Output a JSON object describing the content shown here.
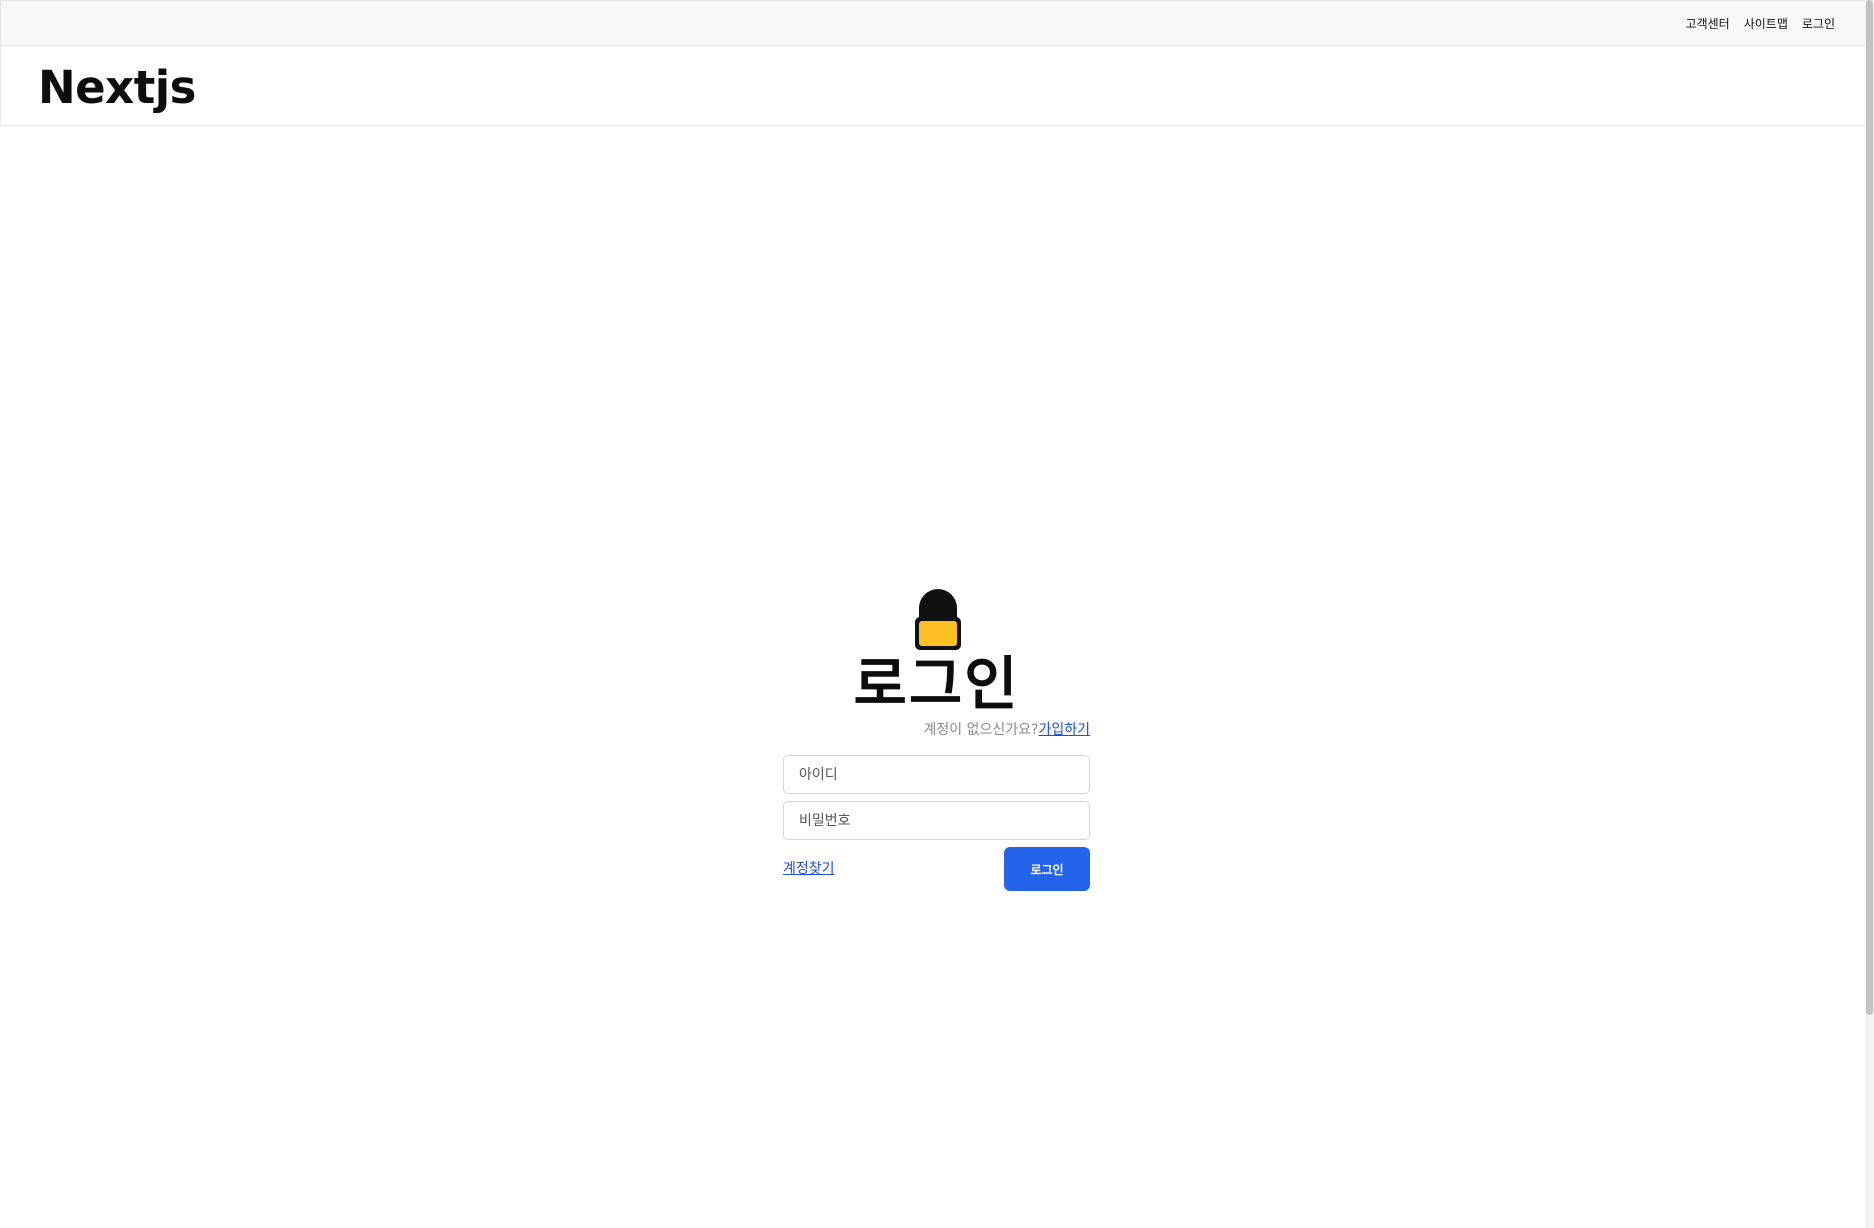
{
  "util_nav": {
    "items": [
      {
        "label": "고객센터"
      },
      {
        "label": "사이트맵"
      },
      {
        "label": "로그인"
      }
    ]
  },
  "header": {
    "logo": "Nextjs"
  },
  "login": {
    "title": "로그인",
    "lock_icon": "lock-icon",
    "signup_prompt": "계정이 없으신가요?",
    "signup_link": "가입하기",
    "id_placeholder": "아이디",
    "password_placeholder": "비밀번호",
    "find_account": "계정찾기",
    "submit_label": "로그인"
  },
  "colors": {
    "accent": "#2563eb",
    "link": "#1d4ed8",
    "lock_body": "#fbbf24",
    "util_bar_bg": "#f7f8f7"
  }
}
